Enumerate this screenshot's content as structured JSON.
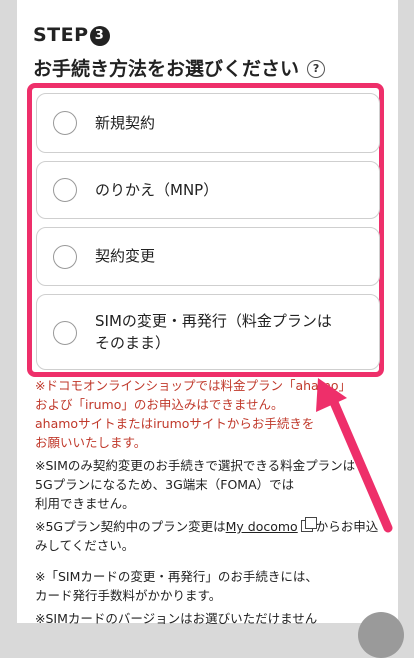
{
  "step": {
    "prefix": "STEP",
    "number": "3"
  },
  "heading": "お手続き方法をお選びください",
  "help_icon": "question-mark-icon",
  "options": [
    {
      "label": "新規契約",
      "selected": false
    },
    {
      "label": "のりかえ（MNP）",
      "selected": false
    },
    {
      "label": "契約変更",
      "selected": false
    },
    {
      "label": "SIMの変更・再発行（料金プランはそのまま）",
      "selected": false
    }
  ],
  "notes": {
    "red": [
      "※ドコモオンラインショップでは料金プラン「ahamo」",
      "および「irumo」のお申込みはできません。",
      "ahamoサイトまたはirumoサイトからお手続きを",
      "お願いいたします。"
    ],
    "sim_only": [
      "※SIMのみ契約変更のお手続きで選択できる料金プランは",
      "5Gプランになるため、3G端末（FOMA）では",
      "利用できません。"
    ],
    "plan_change_prefix": "※5Gプラン契約中のプラン変更は",
    "plan_change_link": "My docomo",
    "plan_change_suffix": "からお申込",
    "plan_change_line2": "みしてください。",
    "sim_card": [
      "※「SIMカードの変更・再発行」のお手続きには、",
      "カード発行手数料がかかります。"
    ],
    "cut_line": "※SIMカードのバージョンはお選びいただけません"
  },
  "colors": {
    "highlight": "#ee2f6a",
    "note_red": "#c0392b",
    "background": "#d9d9d9"
  }
}
